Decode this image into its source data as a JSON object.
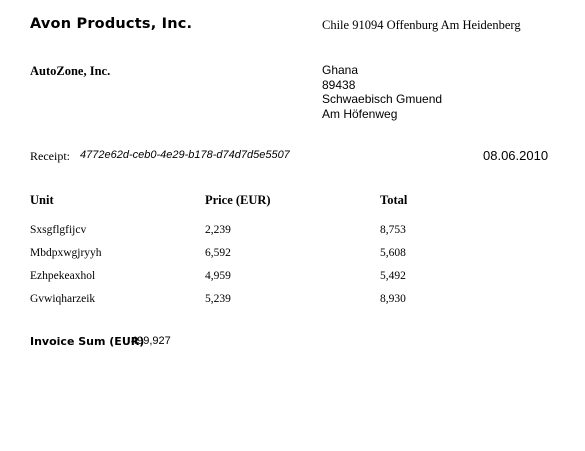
{
  "seller": {
    "name": "Avon Products, Inc.",
    "address": "Chile 91094 Offenburg Am Heidenberg"
  },
  "customer": {
    "name": "AutoZone, Inc.",
    "address_lines": [
      "Ghana",
      "89438",
      "Schwaebisch Gmuend",
      "Am Höfenweg"
    ]
  },
  "receipt": {
    "label": "Receipt:",
    "id": "4772e62d-ceb0-4e29-b178-d74d7d5e5507",
    "date": "08.06.2010"
  },
  "table": {
    "headers": [
      "Unit",
      "Price (EUR)",
      "Total"
    ],
    "rows": [
      [
        "Sxsgflgfijcv",
        "2,239",
        "8,753"
      ],
      [
        "Mbdpxwgjryyh",
        "6,592",
        "5,608"
      ],
      [
        "Ezhpekeaxhol",
        "4,959",
        "5,492"
      ],
      [
        "Gvwiqharzeik",
        "5,239",
        "8,930"
      ]
    ]
  },
  "invoice_sum": {
    "label": "Invoice Sum (EUR)",
    "value": "499,927"
  }
}
